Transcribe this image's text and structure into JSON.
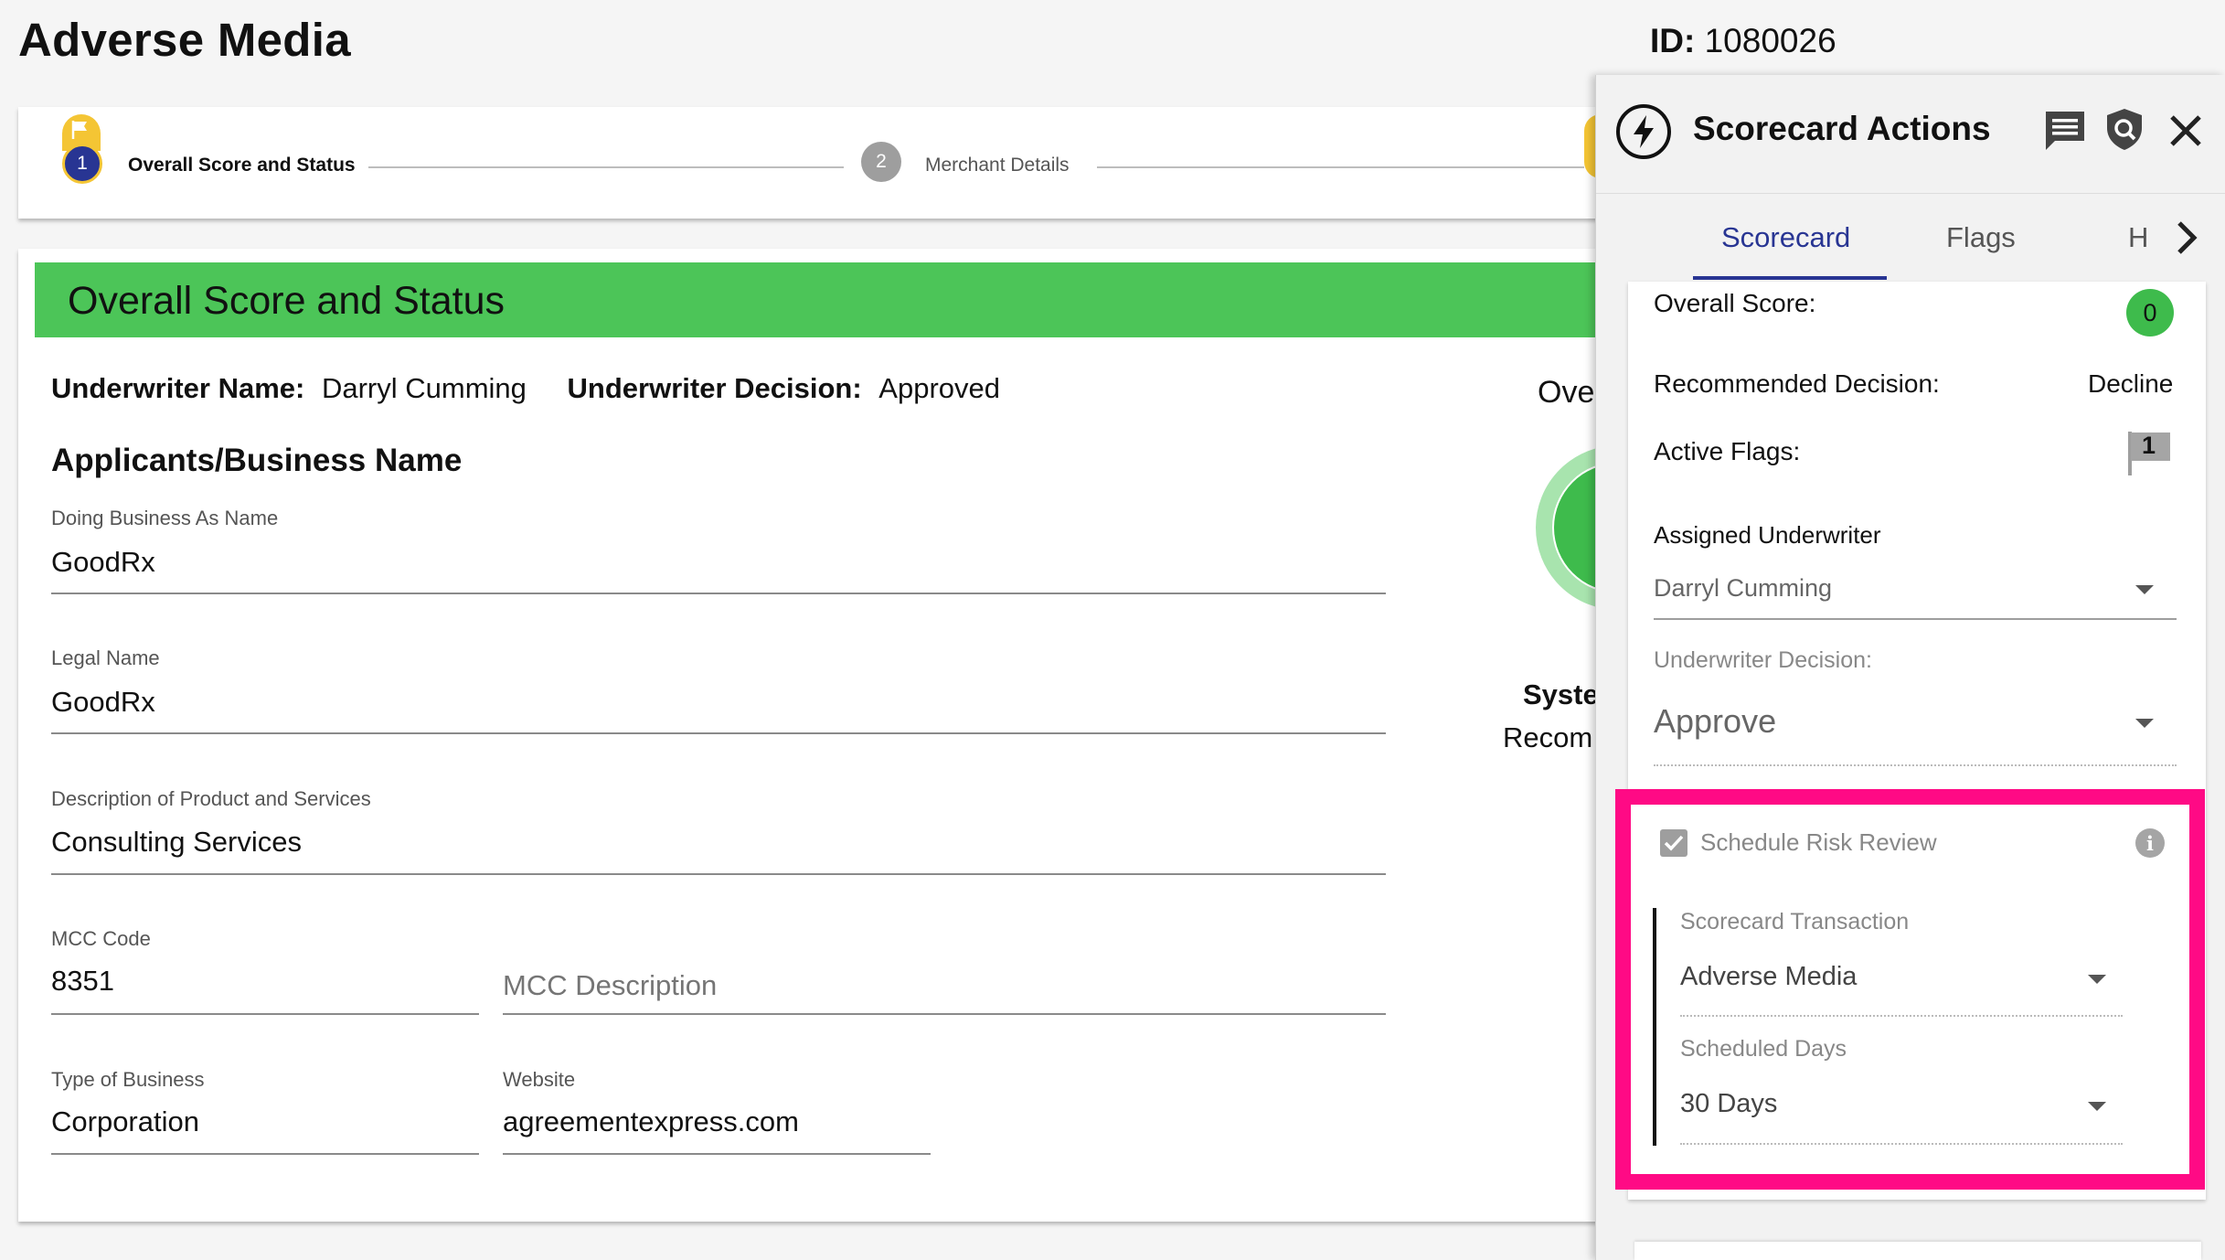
{
  "page": {
    "title": "Adverse Media",
    "id_label": "ID:",
    "id_value": "1080026"
  },
  "stepper": {
    "steps": [
      {
        "number": "1",
        "label": "Overall Score and Status"
      },
      {
        "number": "2",
        "label": "Merchant Details"
      }
    ]
  },
  "main": {
    "banner_title": "Overall Score and Status",
    "underwriter_name_label": "Underwriter Name:",
    "underwriter_name": "Darryl Cumming",
    "underwriter_decision_label": "Underwriter Decision:",
    "underwriter_decision": "Approved",
    "section_heading": "Applicants/Business Name",
    "fields": {
      "dba": {
        "label": "Doing Business As Name",
        "value": "GoodRx"
      },
      "legal": {
        "label": "Legal Name",
        "value": "GoodRx"
      },
      "description": {
        "label": "Description of Product and Services",
        "value": "Consulting Services"
      },
      "mcc": {
        "label": "MCC Code",
        "value": "8351"
      },
      "mcc_desc": {
        "placeholder": "MCC Description"
      },
      "business_type": {
        "label": "Type of Business",
        "value": "Corporation"
      },
      "website": {
        "label": "Website",
        "value": "agreementexpress.com"
      }
    },
    "gauge_partial_label": "Ove",
    "system_partial": "Syste",
    "recommended_partial": "Recom"
  },
  "panel": {
    "title": "Scorecard Actions",
    "tabs": [
      "Scorecard",
      "Flags",
      "H"
    ],
    "overall_score_label": "Overall Score:",
    "overall_score": "0",
    "recommended_decision_label": "Recommended Decision:",
    "recommended_decision": "Decline",
    "active_flags_label": "Active Flags:",
    "active_flags": "1",
    "assigned_underwriter_label": "Assigned Underwriter",
    "assigned_underwriter": "Darryl Cumming",
    "underwriter_decision_label": "Underwriter Decision:",
    "underwriter_decision": "Approve",
    "schedule_risk_review_label": "Schedule Risk Review",
    "scorecard_transaction_label": "Scorecard Transaction",
    "scorecard_transaction": "Adverse Media",
    "scheduled_days_label": "Scheduled Days",
    "scheduled_days": "30 Days"
  },
  "colors": {
    "banner_green": "#4cc558",
    "accent_navy": "#283593",
    "step_yellow": "#f4c534",
    "highlight_pink": "#ff0a85"
  },
  "icons": [
    "flag-icon",
    "lightning-bolt-icon",
    "comment-icon",
    "shield-search-icon",
    "close-icon",
    "chevron-right-icon",
    "dropdown-arrow-icon",
    "info-icon",
    "checkbox-icon"
  ]
}
